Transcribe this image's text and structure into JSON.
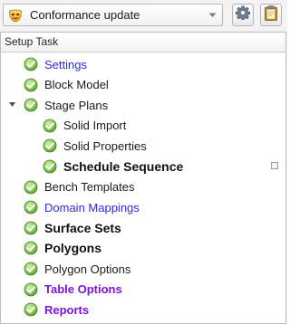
{
  "toolbar": {
    "combo_icon": "mask-icon",
    "combo_value": "Conformance update",
    "settings_icon": "gear-icon",
    "clipboard_icon": "clipboard-icon"
  },
  "panel": {
    "header": "Setup Task",
    "items": [
      {
        "label": "Settings",
        "style": "link",
        "indent": 1,
        "icon": "check-circle-icon"
      },
      {
        "label": "Block Model",
        "style": "normal",
        "indent": 1,
        "icon": "check-circle-icon"
      },
      {
        "label": "Stage Plans",
        "style": "normal",
        "indent": 1,
        "icon": "check-circle-icon",
        "expanded": true
      },
      {
        "label": "Solid Import",
        "style": "normal",
        "indent": 2,
        "icon": "check-circle-icon"
      },
      {
        "label": "Solid Properties",
        "style": "normal",
        "indent": 2,
        "icon": "check-circle-icon"
      },
      {
        "label": "Schedule Sequence",
        "style": "bold",
        "indent": 2,
        "icon": "check-circle-icon",
        "selected_marker": true
      },
      {
        "label": "Bench Templates",
        "style": "normal",
        "indent": 1,
        "icon": "check-circle-icon"
      },
      {
        "label": "Domain Mappings",
        "style": "link",
        "indent": 1,
        "icon": "check-circle-icon"
      },
      {
        "label": "Surface Sets",
        "style": "bold",
        "indent": 1,
        "icon": "check-circle-icon"
      },
      {
        "label": "Polygons",
        "style": "bold",
        "indent": 1,
        "icon": "check-circle-icon"
      },
      {
        "label": "Polygon Options",
        "style": "normal",
        "indent": 1,
        "icon": "check-circle-icon"
      },
      {
        "label": "Table Options",
        "style": "purple",
        "indent": 1,
        "icon": "check-circle-icon"
      },
      {
        "label": "Reports",
        "style": "purple",
        "indent": 1,
        "icon": "check-circle-icon"
      }
    ]
  },
  "colors": {
    "link": "#2b2bd8",
    "purple": "#7a14e0",
    "check_green": "#5aa832"
  }
}
